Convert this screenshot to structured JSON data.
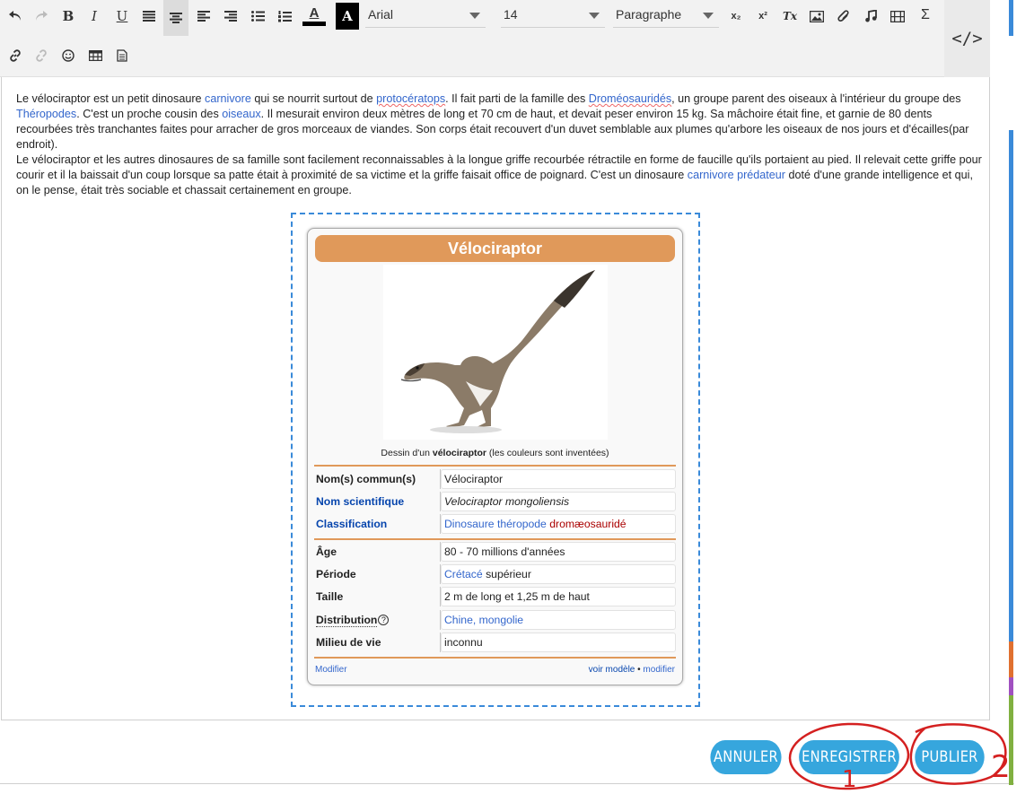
{
  "toolbar": {
    "font_family": "Arial",
    "font_size": "14",
    "block_format": "Paragraphe",
    "bold_glyph": "B",
    "italic_glyph": "I",
    "underline_glyph": "U",
    "sigma_glyph": "Σ",
    "code_glyph": "</>",
    "subscript_glyph": "x₂",
    "superscript_glyph": "x²",
    "clear_format_glyph": "Tx",
    "text_color_glyph": "A",
    "bg_color_glyph": "A",
    "icons": [
      "undo-icon",
      "redo-icon",
      "bold-icon",
      "italic-icon",
      "underline-icon",
      "justify-icon",
      "align-center-icon",
      "align-left-icon",
      "align-right-icon",
      "bullet-list-icon",
      "numbered-list-icon",
      "text-color-icon",
      "background-color-icon",
      "subscript-icon",
      "superscript-icon",
      "clear-format-icon",
      "image-icon",
      "attachment-icon",
      "audio-icon",
      "video-icon",
      "sigma-icon",
      "code-icon",
      "link-icon",
      "unlink-icon",
      "emoji-icon",
      "table-icon",
      "template-icon"
    ]
  },
  "article": {
    "p1": {
      "t1": "Le vélociraptor est un petit dinosaure ",
      "l1": "carnivore",
      "t2": " qui se nourrit surtout de ",
      "l2": "protocératops",
      "t3": ". Il fait parti de la famille des ",
      "l3": "Droméosauridés",
      "t4": ", un groupe parent des oiseaux à l'intérieur du groupe des ",
      "l4": "Théropodes",
      "t5": ". C'est un proche cousin des ",
      "l5": "oiseaux",
      "t6": ". Il mesurait environ deux mètres de long et 70 cm de haut, et devait peser environ 15 kg. Sa mâchoire était fine, et garnie de 80 dents recourbées très tranchantes faites pour arracher de gros morceaux de viandes. Son corps était recouvert d'un duvet semblable aux plumes qu'arbore les oiseaux de nos jours et d'écailles(par endroit)."
    },
    "p2": {
      "t1": "Le vélociraptor et les autres dinosaures de sa famille sont facilement reconnaissables à la longue griffe recourbée rétractile en forme de faucille qu'ils portaient au pied. Il relevait cette griffe pour courir et il la baissait d'un coup lorsque sa patte était à proximité de sa victime et la griffe faisait office de poignard. C'est un dinosaure ",
      "l1": "carnivore prédateur",
      "t2": " doté d'une grande intelligence et qui, on le pense, était très sociable et chassait certainement en groupe."
    }
  },
  "infobox": {
    "title": "Vélociraptor",
    "caption_pre": "Dessin d'un ",
    "caption_bold": "vélociraptor",
    "caption_post": " (les couleurs sont inventées)",
    "rows": [
      {
        "key": "Nom(s) commun(s)",
        "value": "Vélociraptor"
      },
      {
        "key": "Nom scientifique",
        "value": "Velociraptor mongoliensis"
      },
      {
        "key": "Classification",
        "value_link": "Dinosaure théropode",
        "value_red": " dromæosauridé"
      },
      {
        "key": "Âge",
        "value": "80 - 70 millions d'années"
      },
      {
        "key": "Période",
        "value_link": "Crétacé",
        "value_rest": " supérieur"
      },
      {
        "key": "Taille",
        "value": "2 m de long et 1,25 m de haut"
      },
      {
        "key": "Distribution",
        "key_suffix": "?",
        "value_link": "Chine, mongolie"
      },
      {
        "key": "Milieu de vie",
        "value": "inconnu"
      }
    ],
    "footer_left": "Modifier",
    "footer_right_1": "voir modèle",
    "footer_sep": " • ",
    "footer_right_2": "modifier"
  },
  "actions": {
    "cancel": "ANNULER",
    "save": "ENREGISTRER",
    "publish": "PUBLIER"
  },
  "annotations": {
    "label_1": "1",
    "label_2": "2",
    "color": "#d42020"
  }
}
